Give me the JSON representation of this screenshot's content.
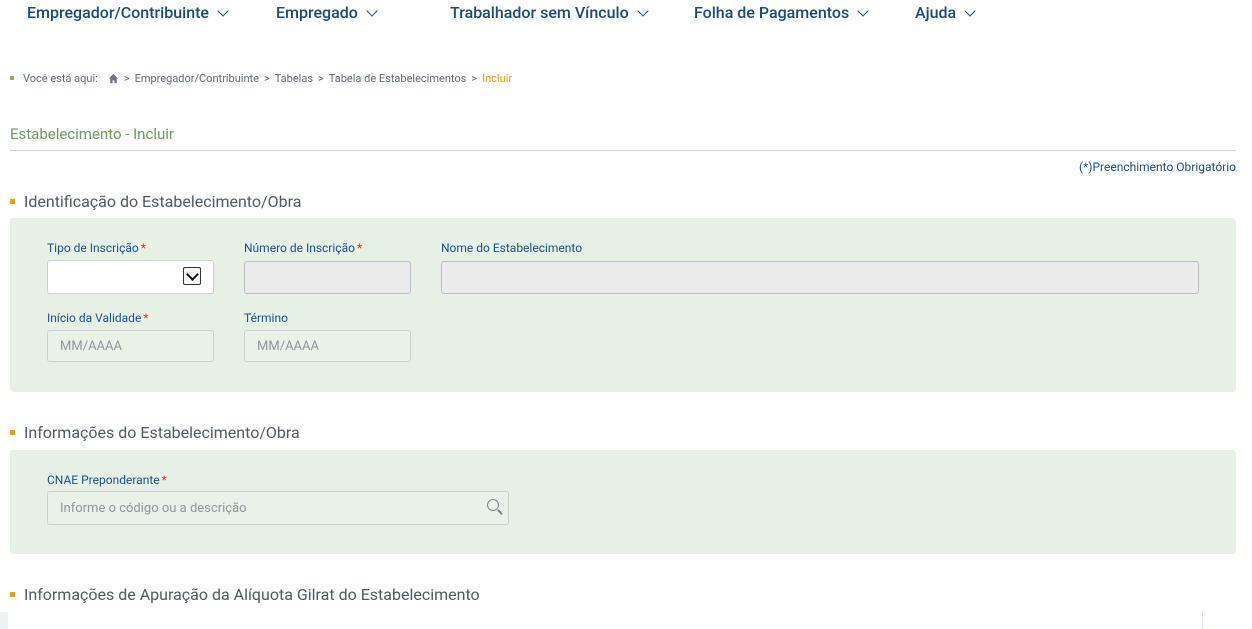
{
  "nav": {
    "items": [
      {
        "label": "Empregador/Contribuinte"
      },
      {
        "label": "Empregado"
      },
      {
        "label": "Trabalhador sem Vínculo"
      },
      {
        "label": "Folha de Pagamentos"
      },
      {
        "label": "Ajuda"
      }
    ]
  },
  "breadcrumb": {
    "prefix": "Você está aqui:",
    "items": [
      "Empregador/Contribuinte",
      "Tabelas",
      "Tabela de Estabelecimentos"
    ],
    "current": "Incluir"
  },
  "page": {
    "title": "Estabelecimento - Incluir",
    "required_note": "(*)Preenchimento Obrigatório"
  },
  "section1": {
    "title": "Identificação do Estabelecimento/Obra",
    "tipo_inscricao_label": "Tipo de Inscrição",
    "tipo_inscricao_value": "",
    "numero_inscricao_label": "Número de Inscrição",
    "nome_estabelecimento_label": "Nome do Estabelecimento",
    "inicio_validade_label": "Início da Validade",
    "inicio_validade_placeholder": "MM/AAAA",
    "termino_label": "Término",
    "termino_placeholder": "MM/AAAA"
  },
  "section2": {
    "title": "Informações do Estabelecimento/Obra",
    "cnae_label": "CNAE Preponderante",
    "cnae_placeholder": "Informe o código ou a descrição"
  },
  "section3": {
    "title": "Informações de Apuração da Alíquota Gilrat do Estabelecimento"
  },
  "required_marker": "*"
}
